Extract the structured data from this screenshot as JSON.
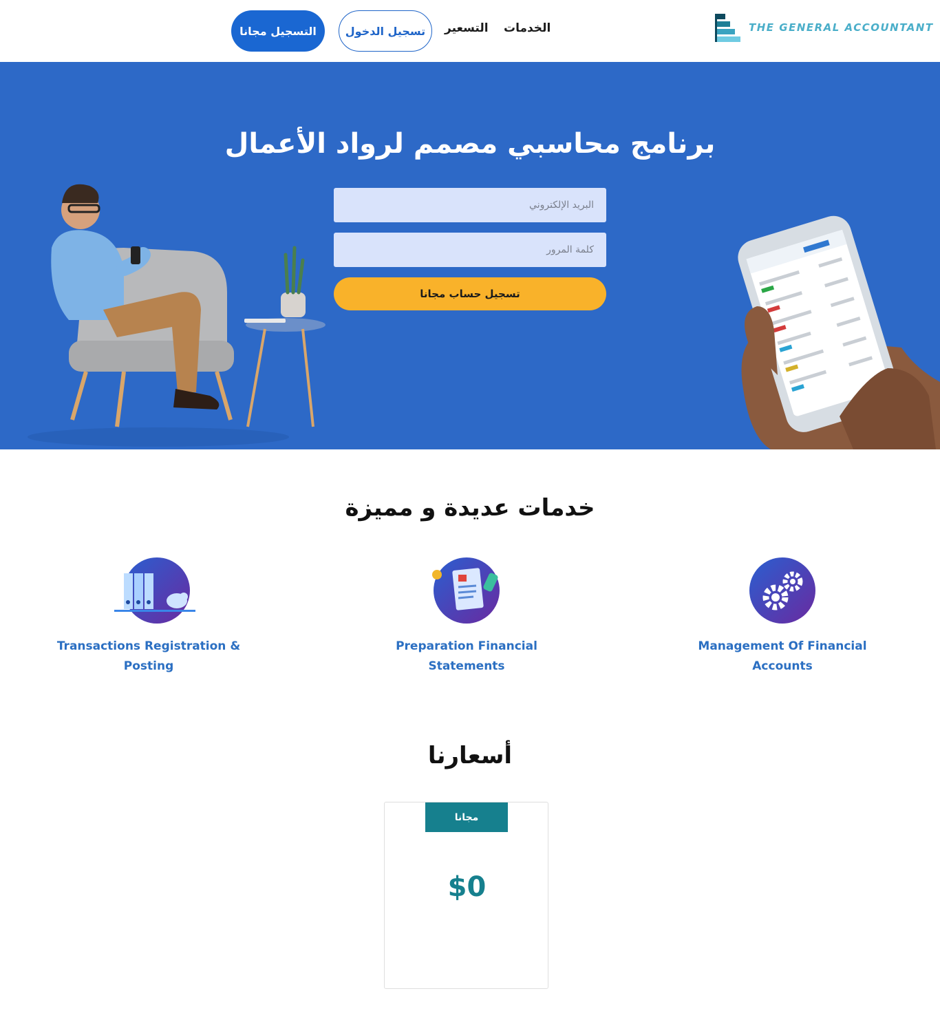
{
  "header": {
    "logo_text": "THE GENERAL ACCOUNTANT",
    "nav": {
      "services": "الخدمات",
      "pricing": "التسعير"
    },
    "login_label": "تسجيل الدخول",
    "signup_label": "التسجيل مجانا"
  },
  "hero": {
    "title": "برنامج محاسبي مصمم لرواد الأعمال",
    "email_placeholder": "البريد الإلكتروني",
    "password_placeholder": "كلمة المرور",
    "cta_label": "تسجيل حساب مجانا"
  },
  "services": {
    "title": "خدمات عديدة و مميزة",
    "items": [
      {
        "label": "Management Of Financial Accounts",
        "icon": "gears-icon"
      },
      {
        "label": "Preparation Financial Statements",
        "icon": "document-icon"
      },
      {
        "label": "Transactions Registration & Posting",
        "icon": "binders-piggy-bank-icon"
      }
    ]
  },
  "pricing": {
    "title": "أسعارنا",
    "plan_name": "مجانا",
    "plan_price": "$0"
  },
  "colors": {
    "brand_blue": "#1a67d2",
    "hero_bg": "#2d69c7",
    "cta_yellow": "#f9b22a",
    "teal": "#16808e",
    "service_text": "#2b6fc2"
  }
}
